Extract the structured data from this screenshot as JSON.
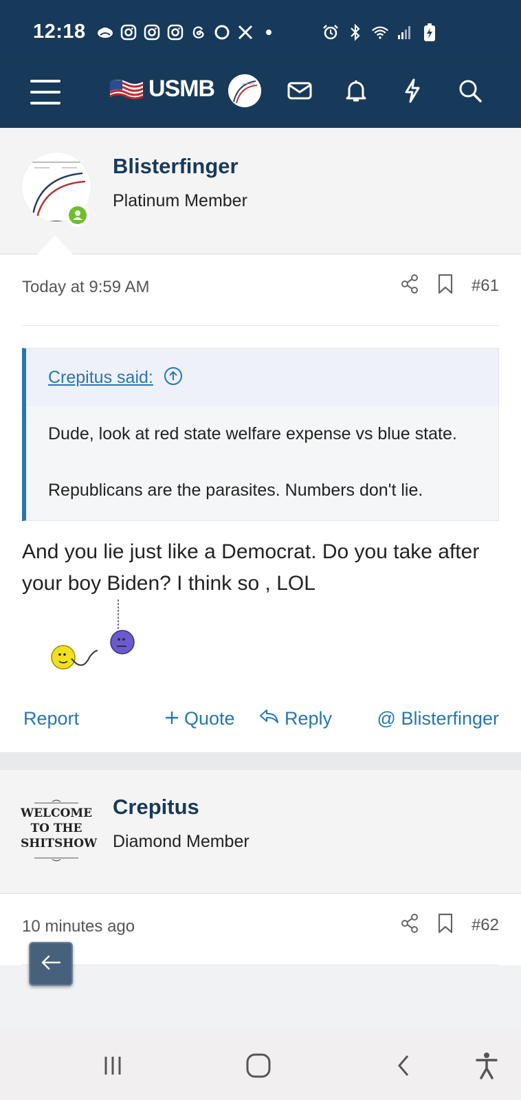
{
  "status_bar": {
    "time": "12:18",
    "notification_icons": [
      "cloud-icon",
      "instagram-icon",
      "instagram-icon",
      "instagram-icon",
      "threads-icon",
      "circle-icon",
      "x-icon",
      "dot-icon"
    ],
    "system_icons": [
      "alarm-icon",
      "bluetooth-icon",
      "wifi-icon",
      "signal-icon",
      "battery-charging-icon"
    ]
  },
  "nav": {
    "logo_text": "USMB",
    "icons": [
      "mail-icon",
      "bell-icon",
      "bolt-icon",
      "search-icon"
    ]
  },
  "posts": [
    {
      "username": "Blisterfinger",
      "user_title": "Platinum Member",
      "date": "Today at 9:59 AM",
      "number": "#61",
      "quote": {
        "author_label": "Crepitus said:",
        "paragraphs": [
          "Dude, look at red state welfare expense vs blue state.",
          "Republicans are the parasites. Numbers don't lie."
        ]
      },
      "body": "And you lie just like a Democrat. Do you take after your boy Biden? I think so , LOL",
      "actions": {
        "report": "Report",
        "quote": "Quote",
        "reply": "Reply",
        "mention": "@ Blisterfinger"
      }
    },
    {
      "username": "Crepitus",
      "user_title": "Diamond Member",
      "avatar_text": [
        "WELCOME",
        "TO THE",
        "SHITSHOW"
      ],
      "date": "10 minutes ago",
      "number": "#62"
    }
  ],
  "colors": {
    "header": "#183a5a",
    "link": "#2577b1",
    "quote_bar": "#2577b1",
    "online": "#6fbf2d"
  }
}
